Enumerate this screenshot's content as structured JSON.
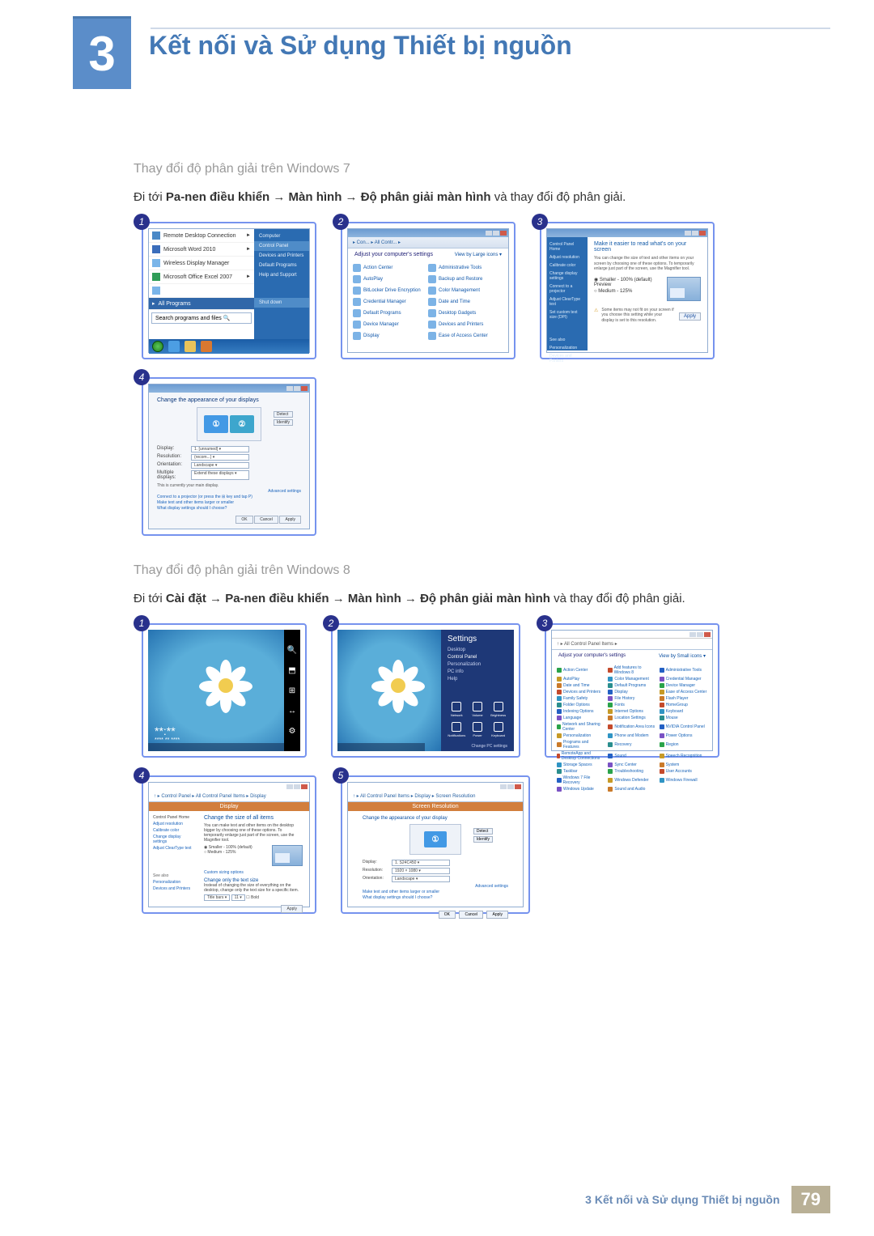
{
  "chapter": {
    "number": "3",
    "title": "Kết nối và Sử dụng Thiết bị nguồn"
  },
  "win7": {
    "subheading": "Thay đổi độ phân giải trên Windows 7",
    "instruction_pre": "Đi tới ",
    "path": [
      "Pa-nen điều khiển",
      "Màn hình",
      "Độ phân giải màn hình"
    ],
    "instruction_post": " và thay đổi độ phân giải.",
    "step1": {
      "left_items": [
        "Remote Desktop Connection",
        "Microsoft Word 2010",
        "Wireless Display Manager",
        "Microsoft Office Excel 2007"
      ],
      "all_programs": "All Programs",
      "search_placeholder": "Search programs and files",
      "right_items": [
        "Computer",
        "Control Panel",
        "Devices and Printers",
        "Default Programs",
        "Help and Support"
      ],
      "shutdown": "Shut down"
    },
    "step2": {
      "address": "▸ Con... ▸ All Contr... ▸",
      "header": "Adjust your computer's settings",
      "view": "View by   Large icons ▾",
      "items": [
        "Action Center",
        "Administrative Tools",
        "AutoPlay",
        "Backup and Restore",
        "BitLocker Drive Encryption",
        "Color Management",
        "Credential Manager",
        "Date and Time",
        "Default Programs",
        "Desktop Gadgets",
        "Device Manager",
        "Devices and Printers",
        "Display",
        "Ease of Access Center"
      ]
    },
    "step3": {
      "side": [
        "Control Panel Home",
        "Adjust resolution",
        "Calibrate color",
        "Change display settings",
        "Connect to a projector",
        "Adjust ClearType text",
        "Set custom text size (DPI)"
      ],
      "side_foot": [
        "See also",
        "Personalization",
        "Devices and Printers"
      ],
      "title": "Make it easier to read what's on your screen",
      "desc": "You can change the size of text and other items on your screen by choosing one of these options. To temporarily enlarge just part of the screen, use the Magnifier tool.",
      "radios": [
        "Smaller - 100% (default)   Preview",
        "Medium - 125%"
      ],
      "link1": "Some items may not fit on your screen if you choose this setting while your display is set to this resolution.",
      "apply": "Apply"
    },
    "step4": {
      "title": "Change the appearance of your displays",
      "detect": "Detect",
      "identify": "Identify",
      "rows": [
        {
          "l": "Display:",
          "v": "1. [unnamed] ▾"
        },
        {
          "l": "Resolution:",
          "v": "(recom...) ▾"
        },
        {
          "l": "Orientation:",
          "v": "Landscape ▾"
        },
        {
          "l": "Multiple displays:",
          "v": "Extend these displays ▾"
        }
      ],
      "note": "This is currently your main display.",
      "links": [
        "Connect to a projector (or press the ⊞ key and tap P)",
        "Make text and other items larger or smaller",
        "What display settings should I choose?"
      ],
      "advanced": "Advanced settings",
      "buttons": [
        "OK",
        "Cancel",
        "Apply"
      ]
    }
  },
  "win8": {
    "subheading": "Thay đổi độ phân giải trên Windows 8",
    "instruction_pre": "Đi tới ",
    "path": [
      "Cài đặt",
      "Pa-nen điều khiển",
      "Màn hình",
      "Độ phân giải màn hình"
    ],
    "instruction_post": " và thay đổi độ phân giải.",
    "step1": {
      "time": "**:**",
      "date": "**** ** ****",
      "charms": [
        "🔍",
        "⬒",
        "⊞",
        "↔",
        "⚙"
      ]
    },
    "step2": {
      "title": "Settings",
      "items": [
        "Desktop",
        "Control Panel",
        "Personalization",
        "PC info",
        "Help"
      ],
      "grid": [
        "Network",
        "Volume",
        "Brightness",
        "Notifications",
        "Power",
        "Keyboard"
      ],
      "foot": "Change PC settings"
    },
    "step3": {
      "address": "↑ ▸ All Control Panel Items ▸",
      "header": "Adjust your computer's settings",
      "view": "View by   Small icons ▾",
      "items": [
        "Action Center",
        "Add features to Windows 8",
        "Administrative Tools",
        "AutoPlay",
        "Color Management",
        "Credential Manager",
        "Date and Time",
        "Default Programs",
        "Device Manager",
        "Devices and Printers",
        "Display",
        "Ease of Access Center",
        "Family Safety",
        "File History",
        "Flash Player",
        "Folder Options",
        "Fonts",
        "HomeGroup",
        "Indexing Options",
        "Internet Options",
        "Keyboard",
        "Language",
        "Location Settings",
        "Mouse",
        "Network and Sharing Center",
        "Notification Area Icons",
        "NVIDIA Control Panel",
        "Personalization",
        "Phone and Modem",
        "Power Options",
        "Programs and Features",
        "Recovery",
        "Region",
        "RemoteApp and Desktop Connections",
        "Sound",
        "Speech Recognition",
        "Storage Spaces",
        "Sync Center",
        "System",
        "Taskbar",
        "Troubleshooting",
        "User Accounts",
        "Windows 7 File Recovery",
        "Windows Defender",
        "Windows Firewall",
        "Windows Update",
        "Sound and Audio"
      ],
      "colors": [
        "#2aa34a",
        "#c44a2c",
        "#2360c4",
        "#c69a27",
        "#2f94c4",
        "#7a52c4",
        "#ca7a2a",
        "#2a8e8e"
      ]
    },
    "step4": {
      "win_title": "Display",
      "address": "↑ ▸ Control Panel ▸ All Control Panel Items ▸ Display",
      "side_head": "Control Panel Home",
      "side": [
        "Adjust resolution",
        "Calibrate color",
        "Change display settings",
        "Adjust ClearType text"
      ],
      "side_foot": [
        "See also",
        "Personalization",
        "Devices and Printers"
      ],
      "title": "Change the size of all items",
      "desc": "You can make text and other items on the desktop bigger by choosing one of these options. To temporarily enlarge just part of the screen, use the Magnifier tool.",
      "radios": [
        "Smaller - 100% (default)",
        "Medium - 125%"
      ],
      "sec2_title": "Change only the text size",
      "sec2_desc": "Instead of changing the size of everything on the desktop, change only the text size for a specific item.",
      "sel1": "Title bars ▾",
      "sel2": "11 ▾",
      "bold": "Bold",
      "apply": "Apply",
      "custom_link": "Custom sizing options"
    },
    "step5": {
      "win_title": "Screen Resolution",
      "address": "↑ ▸ All Control Panel Items ▸ Display ▸ Screen Resolution",
      "title": "Change the appearance of your display",
      "detect": "Detect",
      "identify": "Identify",
      "rows": [
        {
          "l": "Display:",
          "v": "1. S24C450 ▾"
        },
        {
          "l": "Resolution:",
          "v": "1920 × 1080 ▾"
        },
        {
          "l": "Orientation:",
          "v": "Landscape ▾"
        }
      ],
      "links": [
        "Make text and other items larger or smaller",
        "What display settings should I choose?"
      ],
      "advanced": "Advanced settings",
      "buttons": [
        "OK",
        "Cancel",
        "Apply"
      ]
    }
  },
  "footer": {
    "chapter_ref": "3 Kết nối và Sử dụng Thiết bị nguồn",
    "page": "79"
  }
}
